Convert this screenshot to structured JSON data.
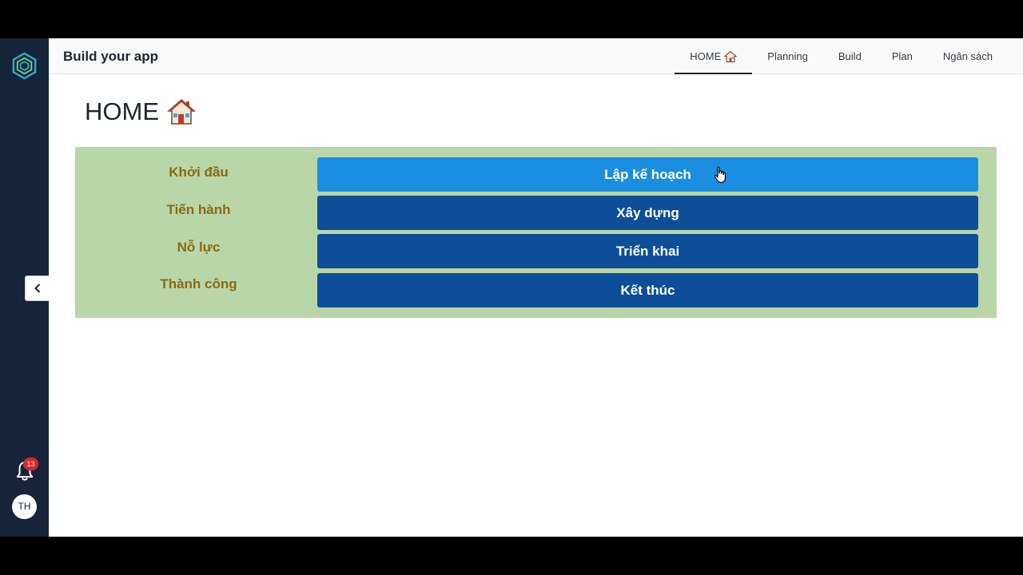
{
  "app": {
    "title": "Build your app"
  },
  "nav": {
    "tabs": [
      {
        "label": "HOME",
        "icon": "house-icon",
        "active": true
      },
      {
        "label": "Planning"
      },
      {
        "label": "Build"
      },
      {
        "label": "Plan"
      },
      {
        "label": "Ngân sách"
      }
    ]
  },
  "page": {
    "title": "HOME",
    "title_icon": "house-icon"
  },
  "rows": [
    {
      "label": "Khởi đầu",
      "button": "Lập kế hoạch",
      "active": true
    },
    {
      "label": "Tiến hành",
      "button": "Xây dựng"
    },
    {
      "label": "Nỗ lực",
      "button": "Triển khai"
    },
    {
      "label": "Thành công",
      "button": "Kết thúc"
    }
  ],
  "sidebar": {
    "notifications_count": "13",
    "avatar_initials": "TH"
  },
  "colors": {
    "sidebar": "#16243a",
    "panel": "#b9d6a9",
    "label": "#8a6a12",
    "button": "#0d4e98",
    "button_active": "#1a8ee0",
    "badge": "#d9262c"
  }
}
